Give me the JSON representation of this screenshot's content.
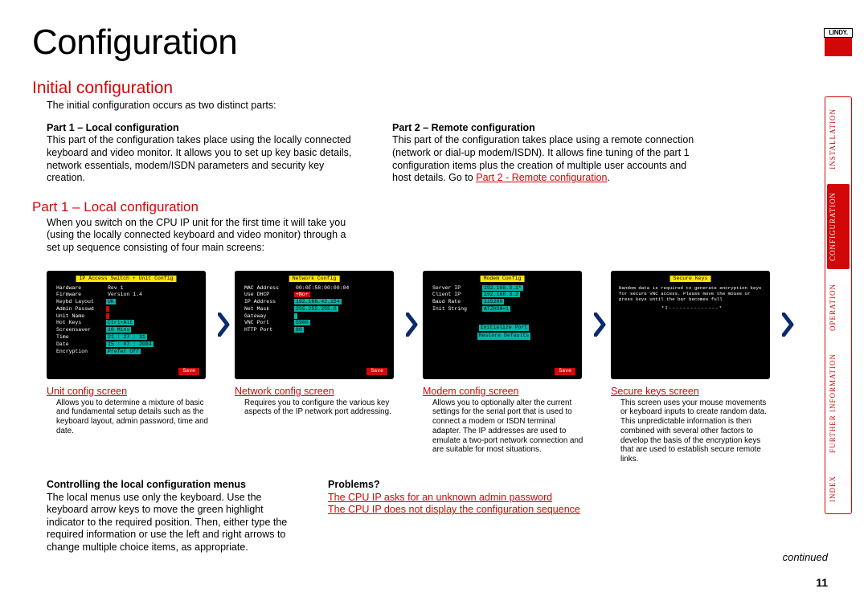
{
  "logo_text": "LINDY.",
  "nav": {
    "items": [
      "INSTALLATION",
      "CONFIGURATION",
      "OPERATION",
      "FURTHER INFORMATION",
      "INDEX"
    ],
    "active_index": 1
  },
  "page": {
    "title": "Configuration",
    "section": "Initial configuration",
    "intro": "The initial configuration occurs as two distinct parts:",
    "part1": {
      "heading": "Part 1 – Local configuration",
      "body": "This part of the configuration takes place using the locally connected keyboard and video monitor. It allows you to set up key basic details, network essentials, modem/ISDN parameters and security key creation."
    },
    "part2": {
      "heading": "Part 2 – Remote configuration",
      "body_a": "This part of the configuration takes place using a remote connection (network or dial-up modem/ISDN). It allows fine tuning of the part 1 configuration items plus the creation of multiple user accounts and host details. Go to ",
      "link": "Part 2 - Remote configuration",
      "body_b": "."
    },
    "part1_head": "Part 1 – Local configuration",
    "part1_intro": "When you switch on the CPU IP unit for the first time it will take you (using the locally connected keyboard and video monitor) through a set up sequence consisting of four main screens:",
    "screens": [
      {
        "title": "IP Access Switch + Unit Config",
        "rows": [
          {
            "k": "Hardware",
            "v": "Rev 1",
            "c": "plain"
          },
          {
            "k": "Firmware",
            "v": "Version 1.4",
            "c": "plain"
          },
          {
            "k": "Keybd Layout",
            "v": "UK",
            "c": "cyan"
          },
          {
            "k": "Admin Passwd",
            "v": "        ",
            "c": "red"
          },
          {
            "k": "Unit Name",
            "v": "        ",
            "c": "red"
          },
          {
            "k": "Hot Keys",
            "v": "Ctrl+Alt",
            "c": "cyan"
          },
          {
            "k": "Screensaver",
            "v": "10 Mins",
            "c": "cyan"
          },
          {
            "k": "Time",
            "v": "21 : 27 : 31",
            "c": "cyan"
          },
          {
            "k": "Date",
            "v": "15 : 07 : 2004",
            "c": "cyan"
          },
          {
            "k": "Encryption",
            "v": "Prefer Off",
            "c": "cyan"
          }
        ],
        "save": "Save",
        "caption_title": "Unit config screen",
        "caption_body": "Allows you to determine a mixture of basic and fundamental setup details such as the keyboard layout, admin password, time and date."
      },
      {
        "title": "Network Config",
        "rows": [
          {
            "k": "MAC Address",
            "v": "00:0F:58:00:00:04",
            "c": "plain"
          },
          {
            "k": "Use DHCP",
            "v": "+No+",
            "c": "red"
          },
          {
            "k": "IP Address",
            "v": "192.168.42.154",
            "c": "cyan"
          },
          {
            "k": "Net Mask",
            "v": "255.255.255.0",
            "c": "cyan"
          },
          {
            "k": "Gateway",
            "v": "        ",
            "c": "cyan"
          },
          {
            "k": "VNC Port",
            "v": "5900",
            "c": "cyan"
          },
          {
            "k": "HTTP Port",
            "v": "80",
            "c": "cyan"
          }
        ],
        "save": "Save",
        "caption_title": "Network config screen",
        "caption_body": "Requires you to configure the various key aspects of the IP network port addressing."
      },
      {
        "title": "Modem Config",
        "rows": [
          {
            "k": "Server IP",
            "v": "192.168.3.1*",
            "c": "cyan"
          },
          {
            "k": "Client IP",
            "v": "192.168.3.2",
            "c": "cyan"
          },
          {
            "k": "Baud Rate",
            "v": "115200",
            "c": "cyan"
          },
          {
            "k": "Init String",
            "v": "ATZHS0=1",
            "c": "cyan"
          }
        ],
        "extras": [
          "Initialize Port",
          "Restore Defaults"
        ],
        "save": "Save",
        "caption_title": "Modem config screen",
        "caption_body": "Allows you to optionally alter the current settings for the serial port that is used to connect a modem or ISDN terminal adapter. The IP addresses are used to emulate a two-port network connection and are suitable for most situations."
      },
      {
        "title": "Secure Keys",
        "text": "Random data is required to generate encryption keys for secure VNC access. Please move the mouse or press keys until the bar becomes full",
        "bar": "*I--------------*",
        "caption_title": "Secure keys screen",
        "caption_body": "This screen uses your mouse movements or keyboard inputs to create random data. This unpredictable information is then combined with several other factors to develop the basis of the encryption keys that are used to establish secure remote links."
      }
    ],
    "bottom": {
      "local_head": "Controlling the local configuration menus",
      "local_body": "The local menus use only the keyboard. Use the keyboard arrow keys to move the green highlight indicator to the required position. Then, either type the required information or use the left and right arrows to change multiple choice items, as appropriate.",
      "problems_head": "Problems?",
      "problems_a": "The CPU IP asks for an unknown admin password",
      "problems_b": "The CPU IP does not display the configuration sequence"
    },
    "continued": "continued",
    "page_number": "11"
  }
}
